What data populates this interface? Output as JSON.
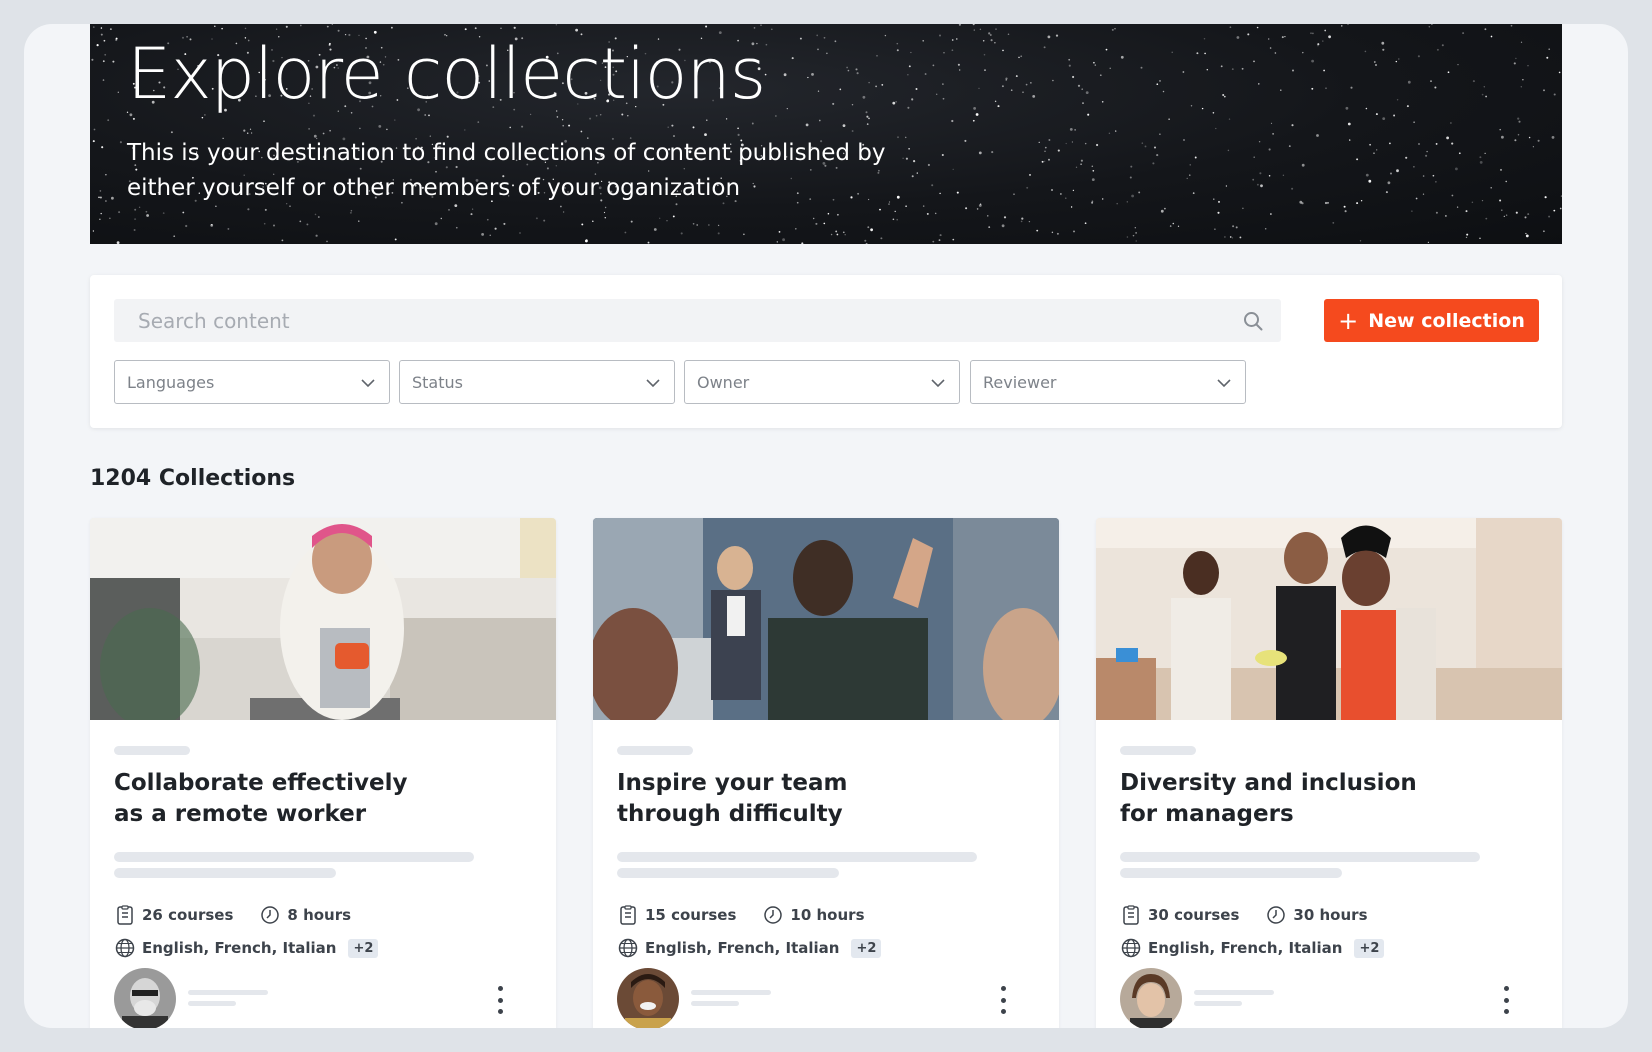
{
  "hero": {
    "title": "Explore collections",
    "description": "This is your destination to find collections of content published by either yourself or other members of your oganization"
  },
  "search": {
    "placeholder": "Search content"
  },
  "new_collection_label": "New collection",
  "filters": [
    "Languages",
    "Status",
    "Owner",
    "Reviewer"
  ],
  "collections_count": "1204 Collections",
  "colors": {
    "accent": "#f54a1e",
    "hero_bg": "#14161a"
  },
  "cards": [
    {
      "title": "Collaborate effectively as a remote worker",
      "courses": "26 courses",
      "hours": "8 hours",
      "languages": "English, French, Italian",
      "extra_languages": "+2",
      "image": "woman-with-mug-kitchen"
    },
    {
      "title": "Inspire your team through difficulty",
      "courses": "15 courses",
      "hours": "10 hours",
      "languages": "English, French, Italian",
      "extra_languages": "+2",
      "image": "presenter-at-podium"
    },
    {
      "title": "Diversity and inclusion for managers",
      "courses": "30 courses",
      "hours": "30 hours",
      "languages": "English, French, Italian",
      "extra_languages": "+2",
      "image": "people-cooking-kitchen"
    }
  ]
}
